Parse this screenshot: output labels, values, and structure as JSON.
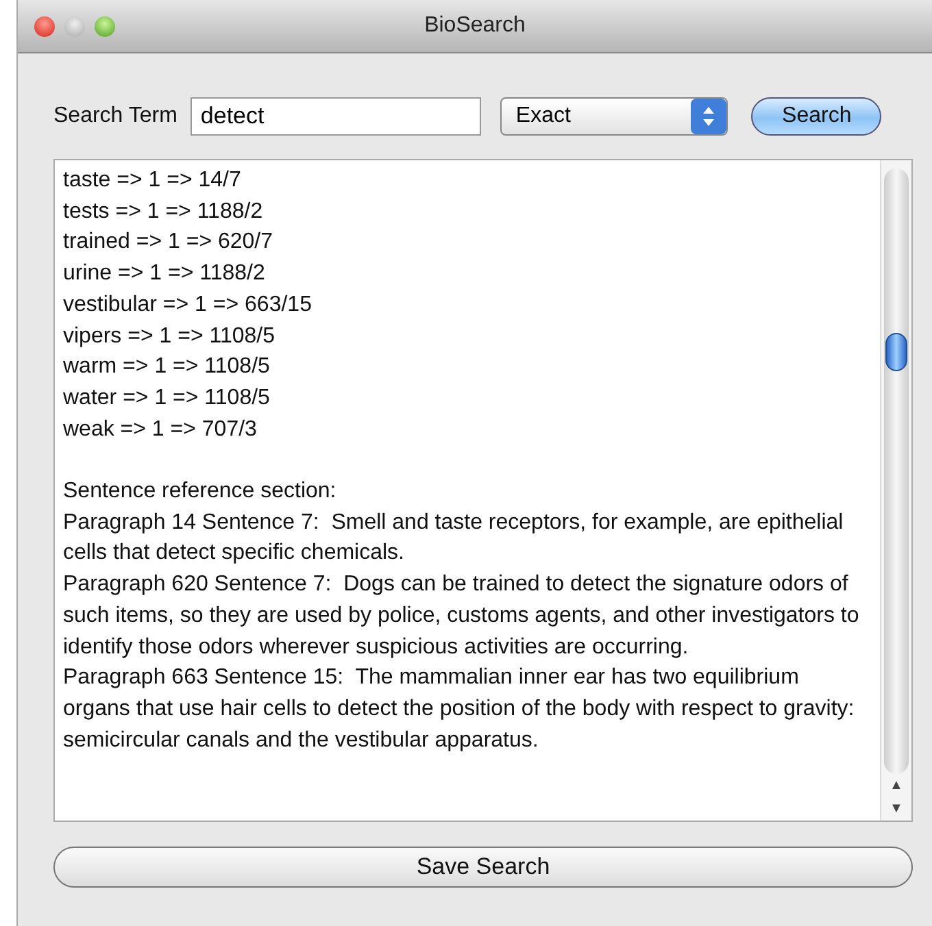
{
  "window": {
    "title": "BioSearch"
  },
  "search": {
    "label": "Search Term",
    "value": "detect",
    "mode": "Exact",
    "button": "Search"
  },
  "results": {
    "lines": [
      "taste => 1 => 14/7",
      "tests => 1 => 1188/2",
      "trained => 1 => 620/7",
      "urine => 1 => 1188/2",
      "vestibular => 1 => 663/15",
      "vipers => 1 => 1108/5",
      "warm => 1 => 1108/5",
      "water => 1 => 1108/5",
      "weak => 1 => 707/3"
    ],
    "section_title": "Sentence reference section:",
    "paragraphs": [
      "Paragraph 14 Sentence 7:  Smell and taste receptors, for example, are epithelial cells that detect specific chemicals.",
      "Paragraph 620 Sentence 7:  Dogs can be trained to detect the signature odors of such items, so they are used by police, customs agents, and other investigators to identify those odors wherever suspicious activities are occurring.",
      "Paragraph 663 Sentence 15:  The mammalian inner ear has two equilibrium organs that use hair cells to detect the position of the body with respect to gravity: semicircular canals and the vestibular apparatus."
    ],
    "scroll_up": "▲",
    "scroll_down": "▼"
  },
  "save_button": "Save Search"
}
